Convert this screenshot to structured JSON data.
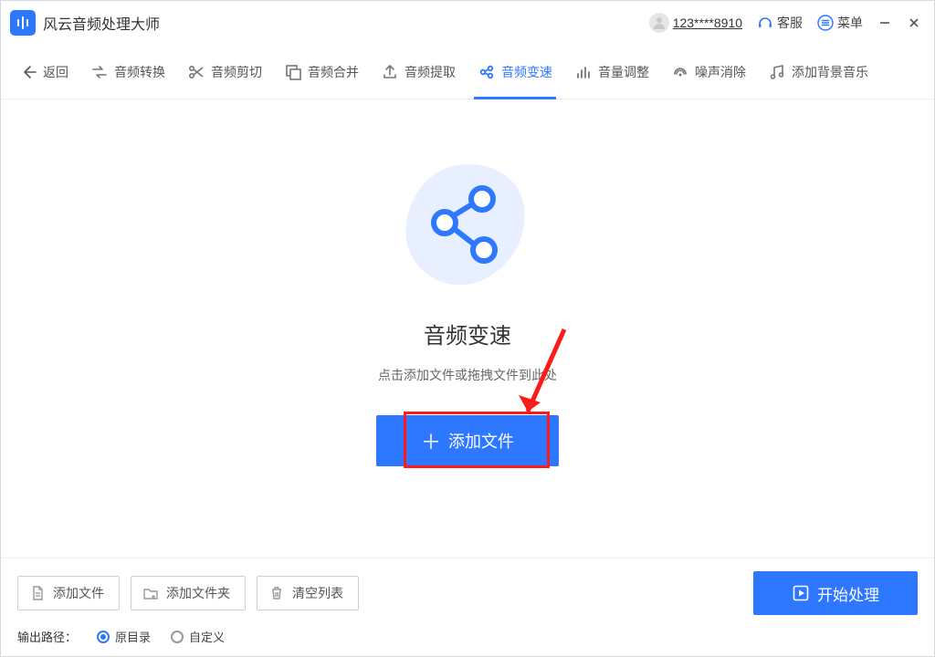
{
  "app": {
    "title": "风云音频处理大师"
  },
  "header": {
    "user_id": "123****8910",
    "support": "客服",
    "menu": "菜单"
  },
  "toolbar": {
    "back": "返回",
    "items": [
      {
        "label": "音频转换",
        "icon": "convert-icon"
      },
      {
        "label": "音频剪切",
        "icon": "cut-icon"
      },
      {
        "label": "音频合并",
        "icon": "merge-icon"
      },
      {
        "label": "音频提取",
        "icon": "extract-icon"
      },
      {
        "label": "音频变速",
        "icon": "speed-icon",
        "active": true
      },
      {
        "label": "音量调整",
        "icon": "volume-icon"
      },
      {
        "label": "噪声消除",
        "icon": "noise-icon"
      },
      {
        "label": "添加背景音乐",
        "icon": "bgm-icon"
      }
    ]
  },
  "main": {
    "title": "音频变速",
    "hint": "点击添加文件或拖拽文件到此处",
    "add_button": "添加文件"
  },
  "bottom": {
    "add_file": "添加文件",
    "add_folder": "添加文件夹",
    "clear_list": "清空列表",
    "start": "开始处理",
    "output_label": "输出路径：",
    "radio_original": "原目录",
    "radio_custom": "自定义",
    "radio_selected": "original"
  },
  "colors": {
    "accent": "#2e78ff",
    "danger": "#ff1a1a"
  }
}
